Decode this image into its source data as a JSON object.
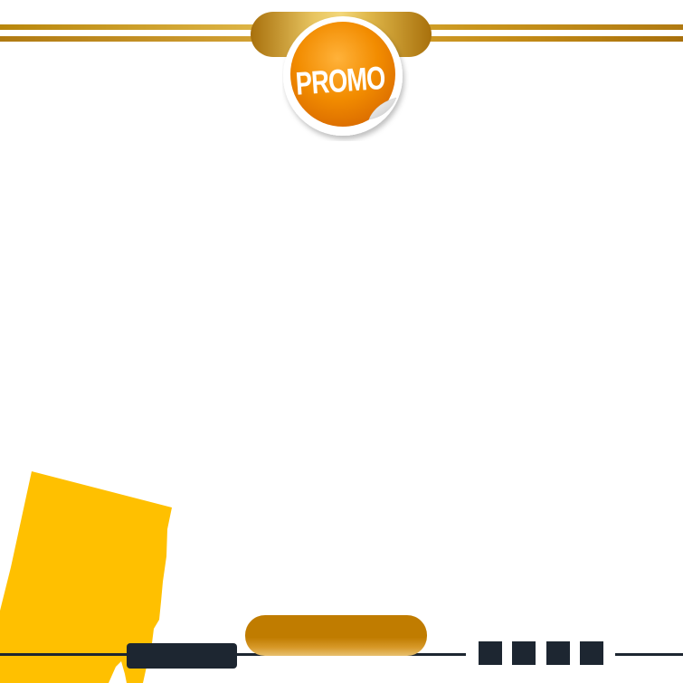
{
  "sticker": {
    "label": "PROMO"
  },
  "colors": {
    "gold": "#c07c00",
    "gold_light": "#f3d77a",
    "navy": "#1d2631",
    "orange": "#f28c00",
    "yellow": "#ffc000"
  },
  "decor": {
    "square_count": 4
  }
}
